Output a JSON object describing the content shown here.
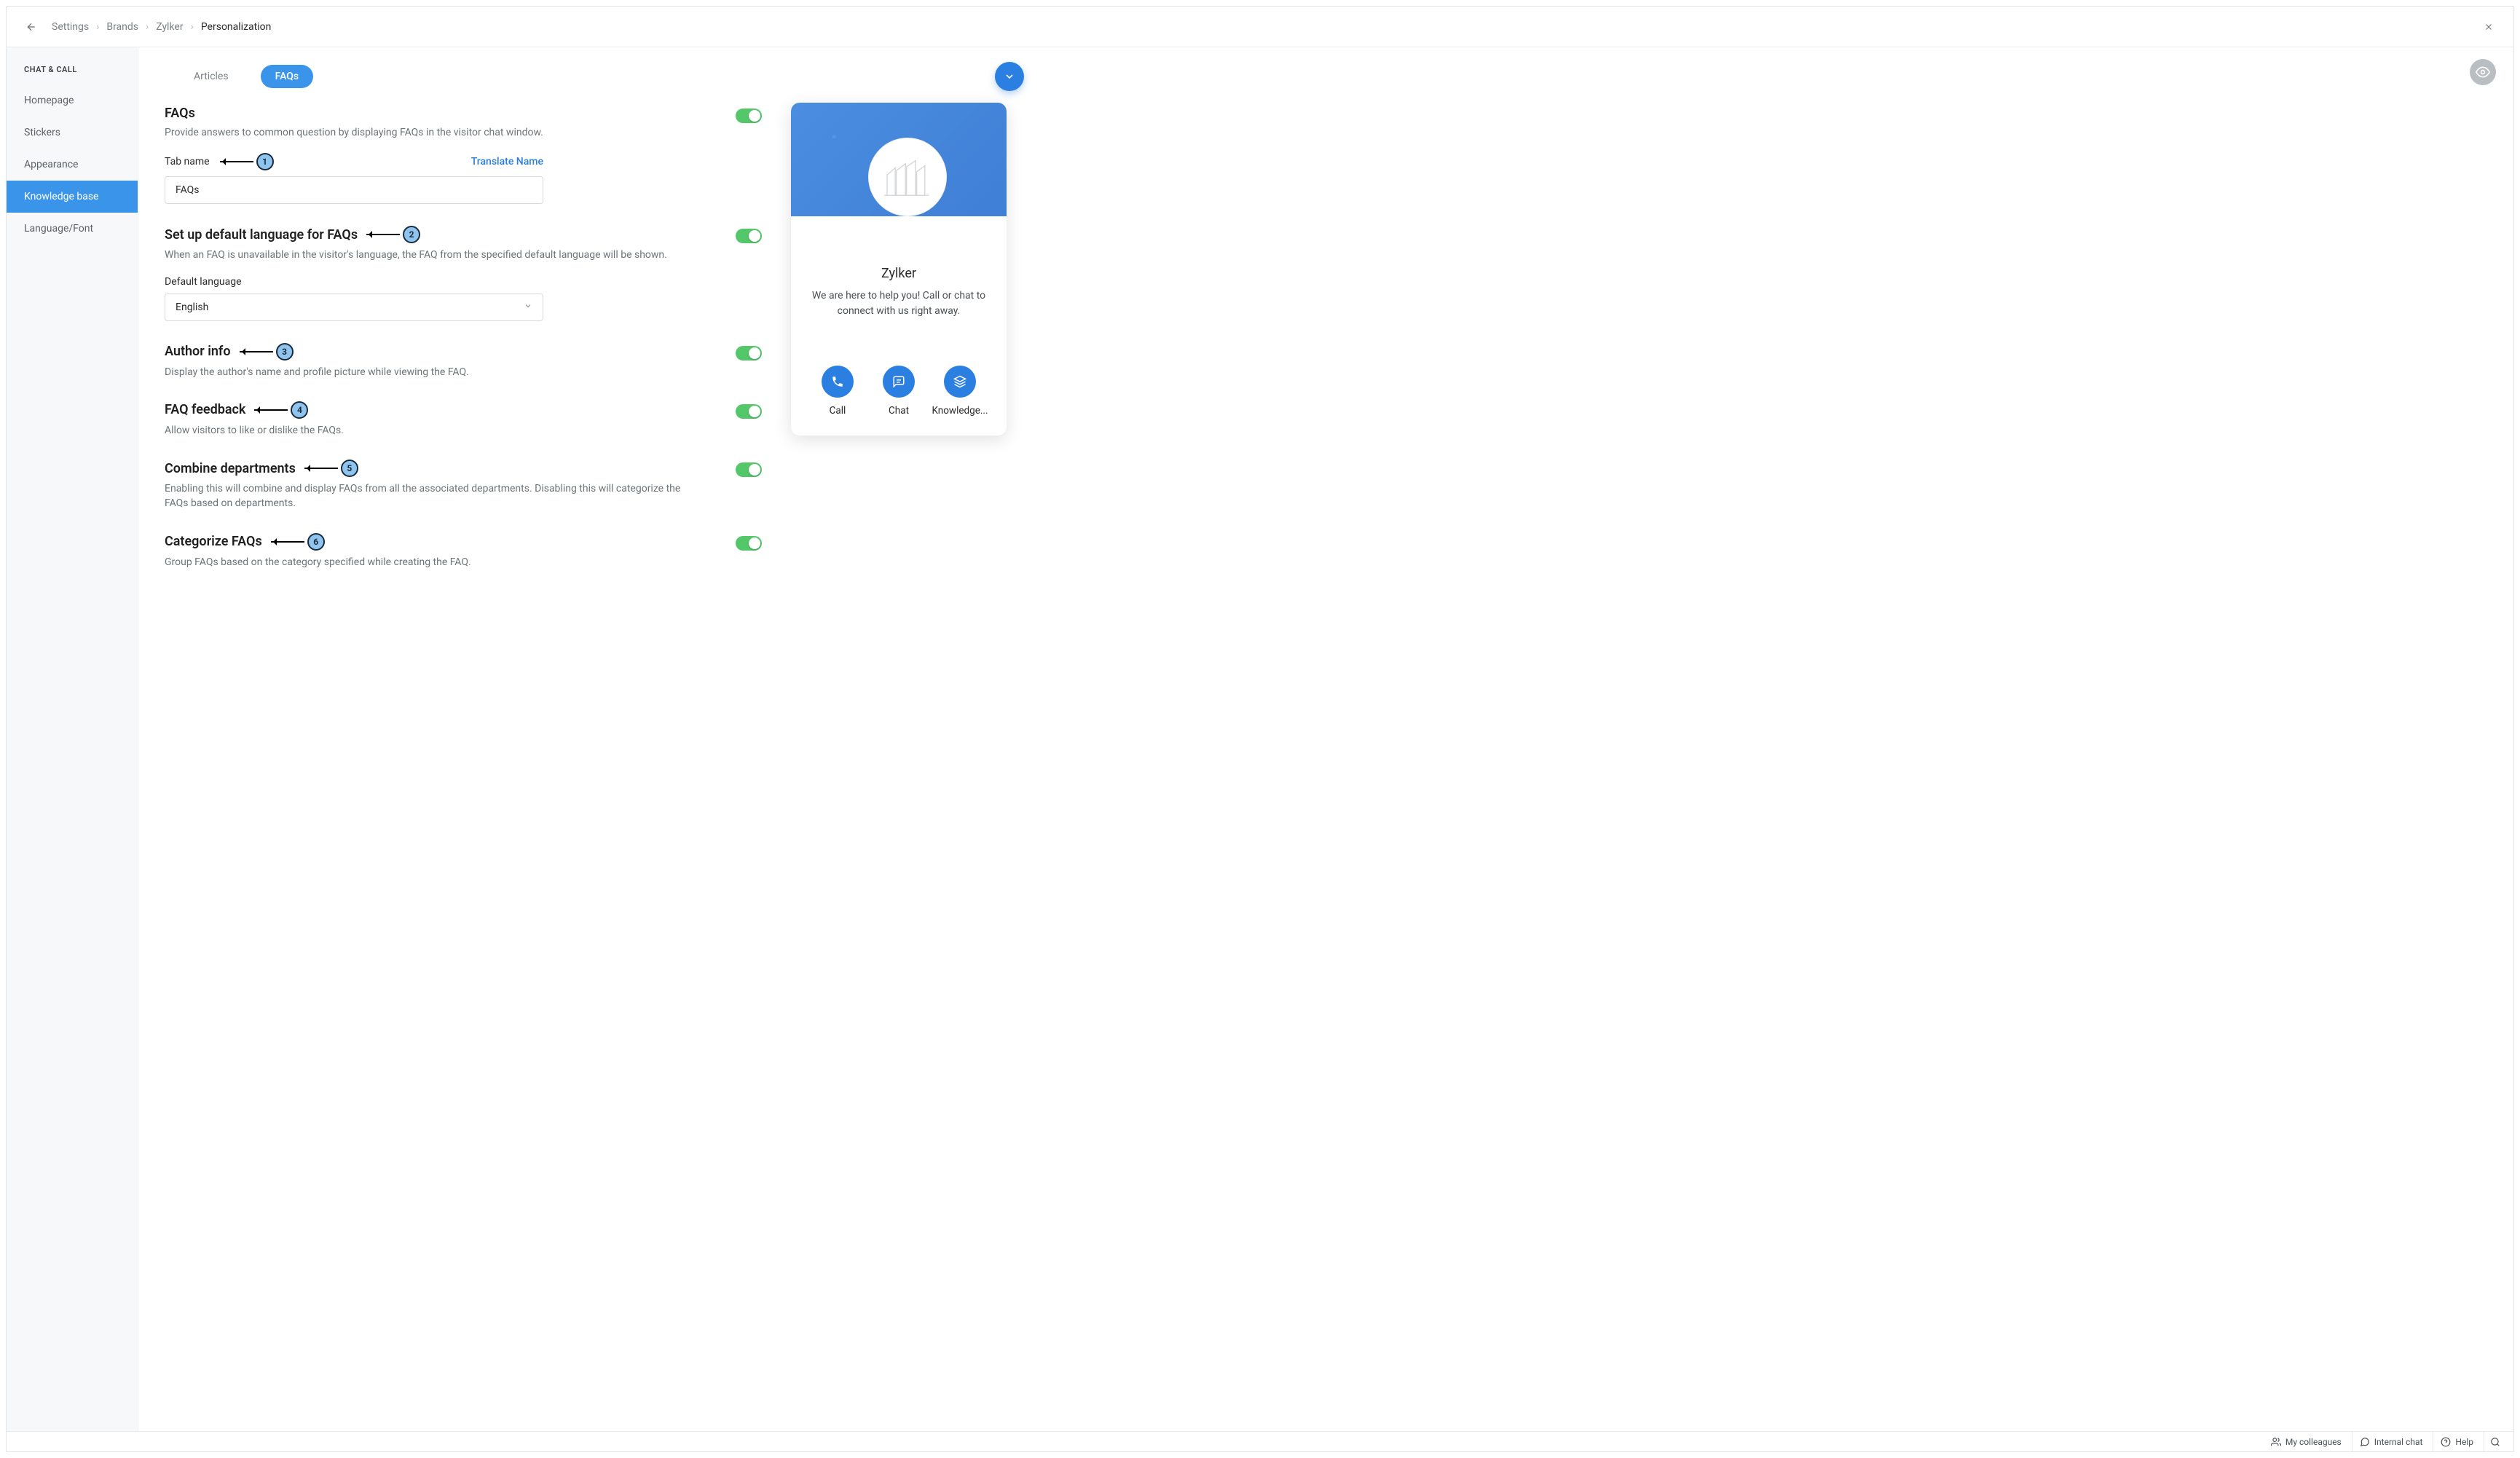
{
  "breadcrumb": {
    "items": [
      "Settings",
      "Brands",
      "Zylker"
    ],
    "current": "Personalization"
  },
  "sidebar": {
    "title": "CHAT & CALL",
    "items": [
      "Homepage",
      "Stickers",
      "Appearance",
      "Knowledge base",
      "Language/Font"
    ],
    "active_index": 3
  },
  "tabs": {
    "items": [
      "Articles",
      "FAQs"
    ],
    "active_index": 1
  },
  "sections": {
    "faqs": {
      "title": "FAQs",
      "desc": "Provide answers to common question by displaying FAQs in the visitor chat window.",
      "tab_name_label": "Tab name",
      "translate_label": "Translate Name",
      "tab_name_value": "FAQs"
    },
    "default_lang": {
      "title": "Set up default language for FAQs",
      "desc": "When an FAQ is unavailable in the visitor's language, the FAQ from the specified default language will be shown.",
      "field_label": "Default language",
      "value": "English"
    },
    "author": {
      "title": "Author info",
      "desc": "Display the author's name and profile picture while viewing the FAQ."
    },
    "feedback": {
      "title": "FAQ feedback",
      "desc": "Allow visitors to like or dislike the FAQs."
    },
    "combine": {
      "title": "Combine departments",
      "desc": "Enabling this will combine and display FAQs from all the associated departments. Disabling this will categorize the FAQs based on departments."
    },
    "categorize": {
      "title": "Categorize FAQs",
      "desc": "Group FAQs based on the category specified while creating the FAQ."
    }
  },
  "annotations": [
    "1",
    "2",
    "3",
    "4",
    "5",
    "6"
  ],
  "preview": {
    "brand": "Zylker",
    "tagline": "We are here to help you! Call or chat to connect with us right away.",
    "actions": [
      "Call",
      "Chat",
      "Knowledge..."
    ]
  },
  "footer": {
    "colleagues": "My colleagues",
    "internal": "Internal chat",
    "help": "Help"
  }
}
